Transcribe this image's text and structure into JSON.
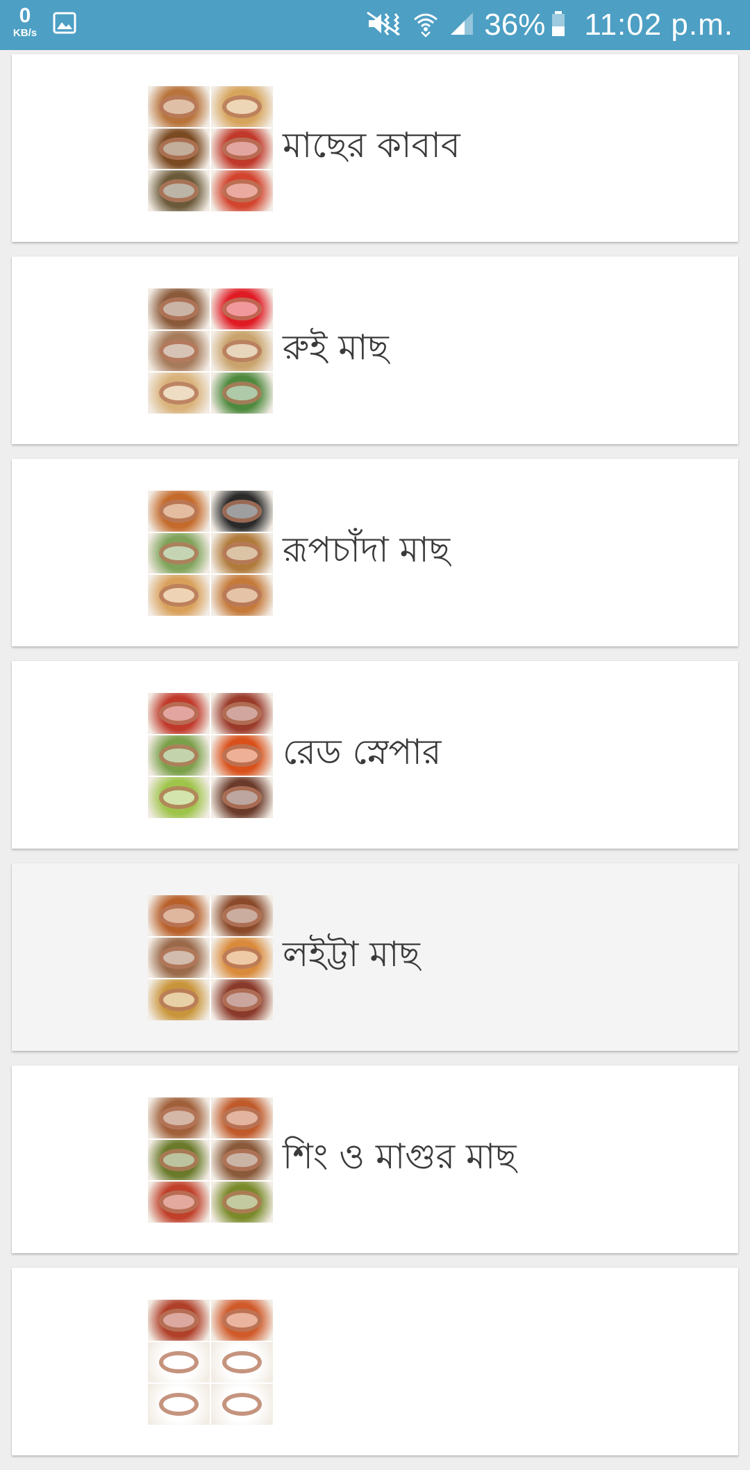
{
  "status_bar": {
    "net_speed_value": "0",
    "net_speed_unit": "KB/s",
    "battery": "36%",
    "time": "11:02 p.m.",
    "icons": [
      "gallery-icon",
      "mute-icon",
      "wifi-icon",
      "signal-icon",
      "battery-icon"
    ],
    "background_color": "#4d9fc4"
  },
  "recipes": [
    {
      "title": "মাছের কাবাব",
      "thumb_colors": [
        "#b8733a",
        "#d7a45c",
        "#7a4a22",
        "#c0392b",
        "#6b5a3a",
        "#d2442e"
      ]
    },
    {
      "title": "রুই মাছ",
      "thumb_colors": [
        "#8a5a3a",
        "#e01b24",
        "#a67b5b",
        "#c9a36b",
        "#d9b27a",
        "#4e8a3e"
      ]
    },
    {
      "title": "রূপচাঁদা মাছ",
      "thumb_colors": [
        "#c46a2a",
        "#2a2a2a",
        "#7fa35a",
        "#b07a3a",
        "#d9a05a",
        "#c57a3a"
      ]
    },
    {
      "title": "রেড স্নেপার",
      "thumb_colors": [
        "#c0392b",
        "#9a3a2a",
        "#7aa04a",
        "#d9501a",
        "#9ec44a",
        "#6a3a2a"
      ]
    },
    {
      "title": "লইট্টা মাছ",
      "thumb_colors": [
        "#b8602a",
        "#8a4a2a",
        "#9a6a4a",
        "#d98a3a",
        "#c9953a",
        "#8a3a2a"
      ]
    },
    {
      "title": "শিং ও মাগুর মাছ",
      "thumb_colors": [
        "#a0603a",
        "#c05a2a",
        "#6a7a2a",
        "#8a5a3a",
        "#c0402a",
        "#7a8a2a"
      ]
    },
    {
      "title": "",
      "thumb_colors": [
        "#b0402a",
        "#d05a2a",
        "#ffffff",
        "#ffffff",
        "#ffffff",
        "#ffffff"
      ]
    }
  ]
}
